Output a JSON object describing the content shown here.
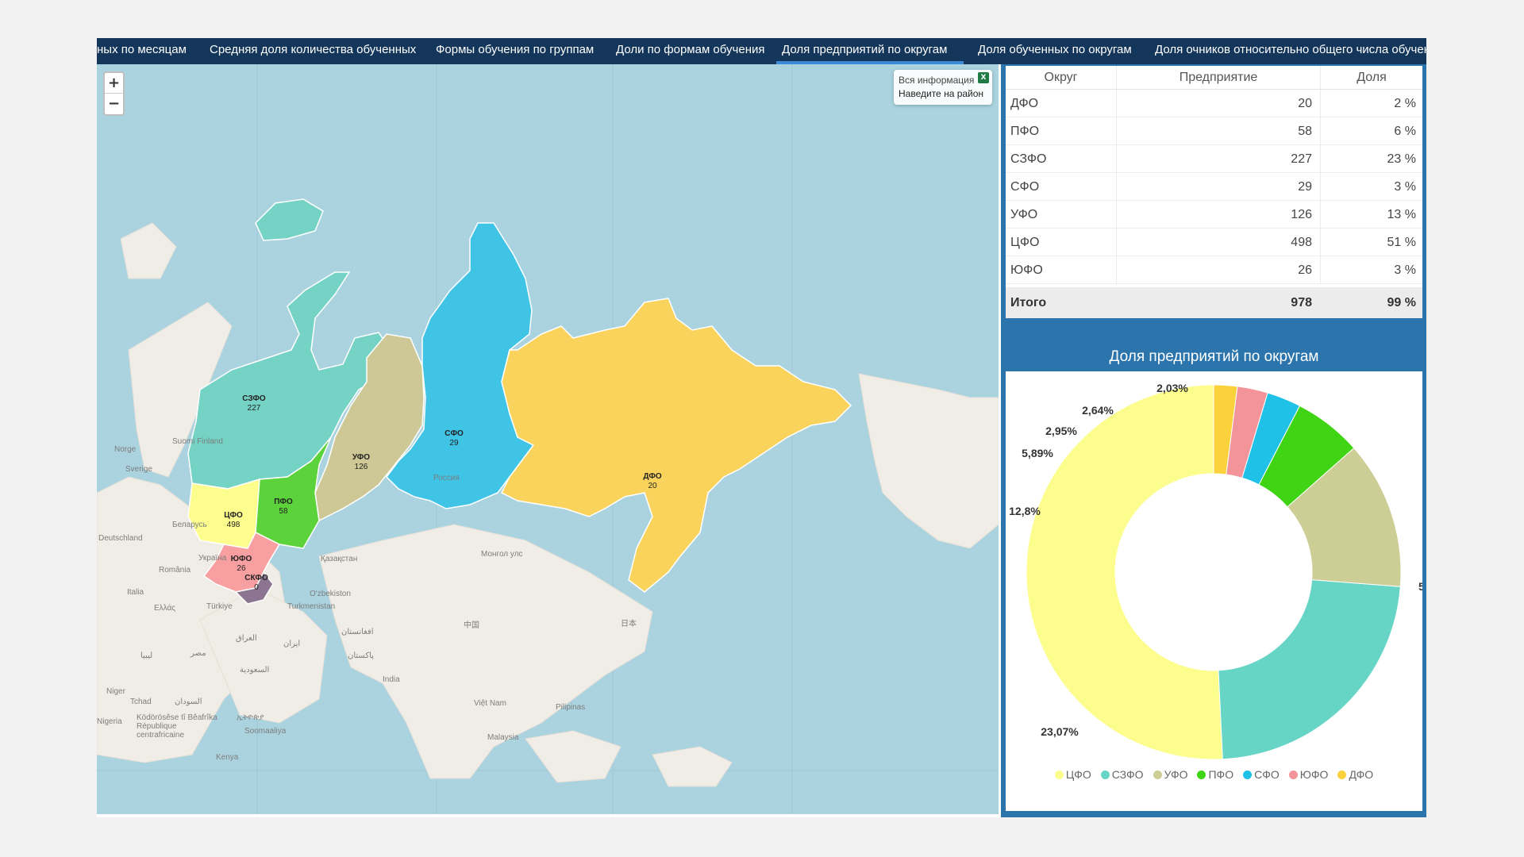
{
  "tabs": [
    {
      "label": "ных по месяцам"
    },
    {
      "label": "Средняя доля количества обученных"
    },
    {
      "label": "Формы обучения по группам"
    },
    {
      "label": "Доли по формам обучения"
    },
    {
      "label": "Доля предприятий по округам",
      "active": true
    },
    {
      "label": "Доля обученных по округам"
    },
    {
      "label": "Доля очников относительно общего числа обученных"
    }
  ],
  "map": {
    "zoom_in": "+",
    "zoom_out": "−",
    "info_line1": "Вся информация",
    "info_line2": "Наведите на район",
    "excel_icon": "excel-export-icon",
    "regions": [
      {
        "code": "СЗФО",
        "value": "227",
        "color": "#74d3c4"
      },
      {
        "code": "УФО",
        "value": "126",
        "color": "#cdc896"
      },
      {
        "code": "СФО",
        "value": "29",
        "color": "#3fc4e6"
      },
      {
        "code": "ДФО",
        "value": "20",
        "color": "#f9d35b"
      },
      {
        "code": "ЦФО",
        "value": "498",
        "color": "#fdfd8d"
      },
      {
        "code": "ПФО",
        "value": "58",
        "color": "#5cd33a"
      },
      {
        "code": "ЮФО",
        "value": "26",
        "color": "#f79fa1"
      },
      {
        "code": "СКФО",
        "value": "0",
        "color": "#8c7591"
      }
    ],
    "geo_labels": [
      "Norge",
      "Sverige",
      "Suomi Finland",
      "Deutschland",
      "Беларусь",
      "Україна",
      "România",
      "Italia",
      "Ελλάς",
      "Türkiye",
      "Қазақстан",
      "O'zbekiston",
      "Turkmenistan",
      "Монгол улс",
      "Россия",
      "中国",
      "日本",
      "India",
      "Việt Nam",
      "Pilipinas",
      "Malaysia",
      "Niger",
      "Tchad",
      "Nigeria",
      "السودان",
      "مصر",
      "ليبيا",
      "العراق",
      "ایران",
      "السعودية",
      "افغانستان",
      "پاکستان",
      "ኢትዮጵያ",
      "Soomaaliya",
      "Kenya",
      "Ködörösêse tî Bêafrîka République centrafricaine"
    ]
  },
  "table": {
    "headers": {
      "district": "Округ",
      "enterprise": "Предприятие",
      "share": "Доля"
    },
    "rows": [
      {
        "district": "ДФО",
        "enterprise": "20",
        "share": "2 %"
      },
      {
        "district": "ПФО",
        "enterprise": "58",
        "share": "6 %"
      },
      {
        "district": "СЗФО",
        "enterprise": "227",
        "share": "23 %"
      },
      {
        "district": "СФО",
        "enterprise": "29",
        "share": "3 %"
      },
      {
        "district": "УФО",
        "enterprise": "126",
        "share": "13 %"
      },
      {
        "district": "ЦФО",
        "enterprise": "498",
        "share": "51 %"
      },
      {
        "district": "ЮФО",
        "enterprise": "26",
        "share": "3 %"
      }
    ],
    "total": {
      "district": "Итого",
      "enterprise": "978",
      "share": "99 %"
    }
  },
  "chart_data": {
    "type": "pie",
    "title": "Доля предприятий по округам",
    "donut": true,
    "categories": [
      "ЦФО",
      "СЗФО",
      "УФО",
      "ПФО",
      "СФО",
      "ЮФО",
      "ДФО"
    ],
    "values": [
      50.92,
      23.07,
      12.8,
      5.89,
      2.95,
      2.64,
      2.03
    ],
    "data_labels": [
      "5",
      "23,07%",
      "12,8%",
      "5,89%",
      "2,95%",
      "2,64%",
      "2,03%"
    ],
    "colors": [
      "#fdfd8d",
      "#67d5c6",
      "#cdcd96",
      "#3fd414",
      "#1fc1e6",
      "#f29499",
      "#fbd23c"
    ],
    "legend_position": "bottom"
  }
}
